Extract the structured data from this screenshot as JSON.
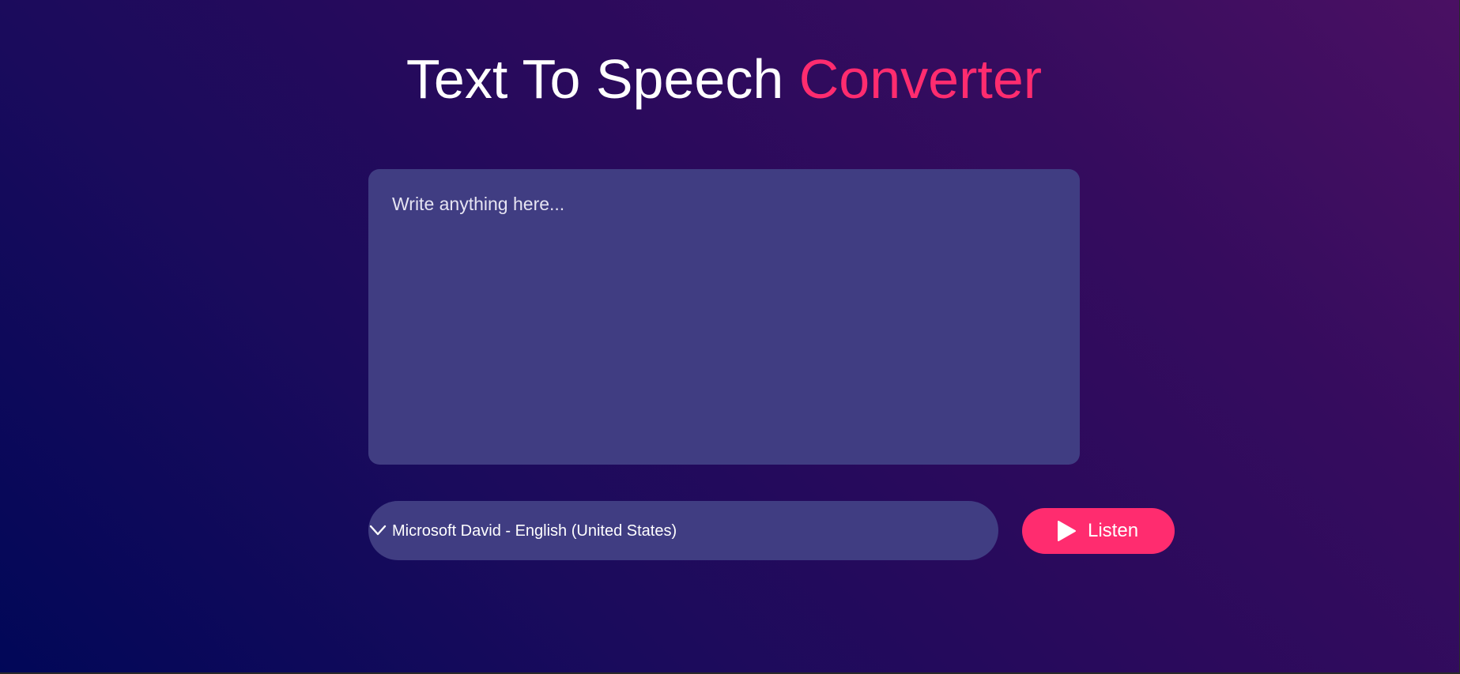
{
  "header": {
    "title_main": "Text To Speech",
    "title_accent": "Converter"
  },
  "editor": {
    "placeholder": "Write anything here...",
    "value": ""
  },
  "voice_select": {
    "selected": "Microsoft David - English (United States)",
    "icon": "chevron-down-icon"
  },
  "listen_button": {
    "label": "Listen",
    "icon": "play-icon"
  },
  "colors": {
    "accent": "#ff2c6f",
    "panel": "#403d82",
    "background_start": "#010758",
    "background_end": "#4a1063",
    "text": "#ffffff"
  }
}
